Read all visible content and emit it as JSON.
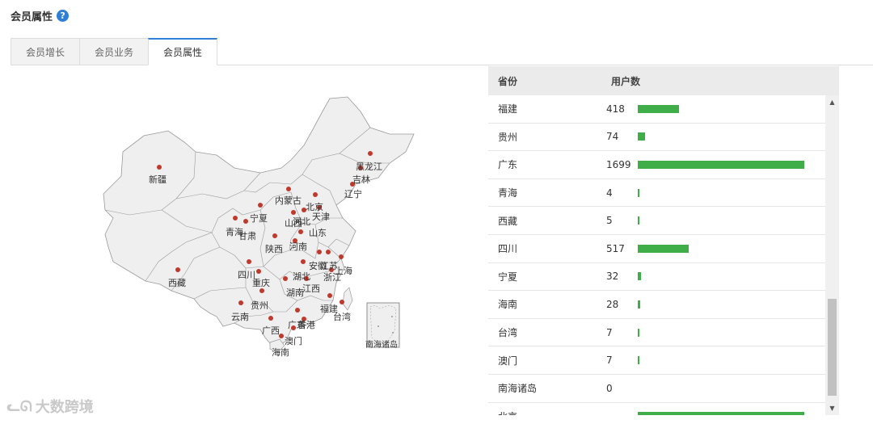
{
  "header": {
    "title": "会员属性",
    "help_icon": "question-circle-icon"
  },
  "tabs": [
    {
      "label": "会员增长",
      "active": false
    },
    {
      "label": "会员业务",
      "active": false
    },
    {
      "label": "会员属性",
      "active": true
    }
  ],
  "map": {
    "labels": {
      "xinjiang": "新疆",
      "heilongjiang": "黑龙江",
      "jilin": "吉林",
      "liaoning": "辽宁",
      "neimenggu": "内蒙古",
      "beijing": "北京",
      "tianjin": "天津",
      "hebei": "河北",
      "shanxi": "山西",
      "ningxia": "宁夏",
      "qinghai": "青海",
      "gansu": "甘肃",
      "shandong": "山东",
      "shaanxi": "陕西",
      "henan": "河南",
      "jiangsu": "江苏",
      "anhui": "安徽",
      "shanghai": "上海",
      "xizang": "西藏",
      "sichuan": "四川",
      "chongqing": "重庆",
      "hubei": "湖北",
      "zhejiang": "浙江",
      "jiangxi": "江西",
      "hunan": "湖南",
      "guizhou": "贵州",
      "fujian": "福建",
      "taiwan": "台湾",
      "yunnan": "云南",
      "guangxi": "广西",
      "guangdong": "广东",
      "xianggang": "香港",
      "aomen": "澳门",
      "hainan": "海南",
      "nanhai": "南海诸岛"
    },
    "region_color": "#efefef",
    "dot_color": "#c0392b"
  },
  "table": {
    "headers": {
      "province": "省份",
      "users": "用户数"
    },
    "bar_color": "#3fae49",
    "max_value": 1699,
    "rows": [
      {
        "province": "福建",
        "users": "418",
        "value": 418
      },
      {
        "province": "贵州",
        "users": "74",
        "value": 74
      },
      {
        "province": "广东",
        "users": "1699",
        "value": 1699
      },
      {
        "province": "青海",
        "users": "4",
        "value": 4
      },
      {
        "province": "西藏",
        "users": "5",
        "value": 5
      },
      {
        "province": "四川",
        "users": "517",
        "value": 517
      },
      {
        "province": "宁夏",
        "users": "32",
        "value": 32
      },
      {
        "province": "海南",
        "users": "28",
        "value": 28
      },
      {
        "province": "台湾",
        "users": "7",
        "value": 7
      },
      {
        "province": "澳门",
        "users": "7",
        "value": 7
      },
      {
        "province": "南海诸岛",
        "users": "0",
        "value": 0
      },
      {
        "province": "北京",
        "users": "",
        "value": 1699
      }
    ]
  },
  "scrollbar": {
    "up_icon": "arrow-up-icon",
    "down_icon": "arrow-down-icon",
    "position": 0.75
  },
  "watermark": {
    "text": "大数跨境"
  }
}
